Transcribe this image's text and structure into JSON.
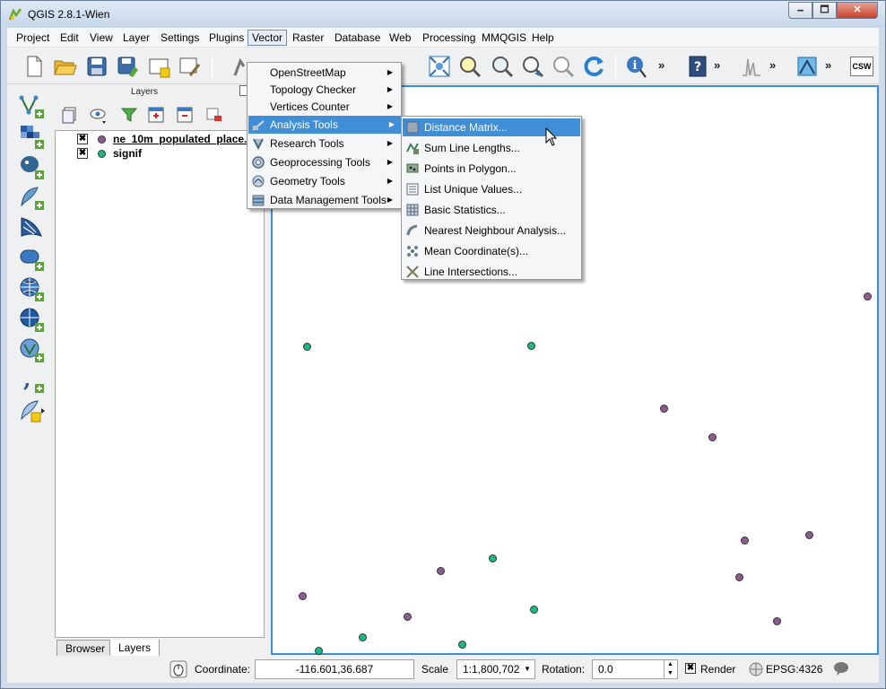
{
  "window": {
    "title": "QGIS 2.8.1-Wien",
    "min_glyph": "🗕",
    "max_glyph": "🗖",
    "close_glyph": "✕"
  },
  "menubar": {
    "items": [
      "Project",
      "Edit",
      "View",
      "Layer",
      "Settings",
      "Plugins",
      "Vector",
      "Raster",
      "Database",
      "Web",
      "Processing",
      "MMQGIS",
      "Help"
    ],
    "active": "Vector"
  },
  "vector_menu": {
    "items": [
      {
        "label": "OpenStreetMap",
        "submenu": true,
        "icon": "none"
      },
      {
        "label": "Topology Checker",
        "submenu": true,
        "icon": "none"
      },
      {
        "label": "Vertices Counter",
        "submenu": true,
        "icon": "none"
      },
      {
        "label": "Analysis Tools",
        "submenu": true,
        "icon": "analysis-icon",
        "highlighted": true
      },
      {
        "label": "Research Tools",
        "submenu": true,
        "icon": "research-icon"
      },
      {
        "label": "Geoprocessing Tools",
        "submenu": true,
        "icon": "geoprocessing-icon"
      },
      {
        "label": "Geometry Tools",
        "submenu": true,
        "icon": "geometry-icon"
      },
      {
        "label": "Data Management Tools",
        "submenu": true,
        "icon": "data-management-icon"
      }
    ]
  },
  "analysis_submenu": {
    "items": [
      {
        "label": "Distance Matrix...",
        "icon": "distance-matrix-icon",
        "highlighted": true
      },
      {
        "label": "Sum Line Lengths...",
        "icon": "sum-line-lengths-icon"
      },
      {
        "label": "Points in Polygon...",
        "icon": "points-in-polygon-icon"
      },
      {
        "label": "List Unique Values...",
        "icon": "list-unique-values-icon"
      },
      {
        "label": "Basic Statistics...",
        "icon": "basic-statistics-icon"
      },
      {
        "label": "Nearest Neighbour Analysis...",
        "icon": "nearest-neighbour-icon"
      },
      {
        "label": "Mean Coordinate(s)...",
        "icon": "mean-coordinate-icon"
      },
      {
        "label": "Line Intersections...",
        "icon": "line-intersections-icon"
      }
    ]
  },
  "layers_panel": {
    "title": "Layers",
    "layers": [
      {
        "name": "ne_10m_populated_place...",
        "visible": true,
        "color": "#8e5b94",
        "check_glyph": "✖"
      },
      {
        "name": "signif",
        "visible": true,
        "color": "#1fb884",
        "check_glyph": "✖"
      }
    ],
    "tabs": [
      "Browser",
      "Layers"
    ],
    "active_tab": "Layers"
  },
  "map_points": {
    "purple": "#8e5b94",
    "green": "#1fb884"
  },
  "statusbar": {
    "coordinate_label": "Coordinate:",
    "coordinate_value": "-116.601,36.687",
    "scale_label": "Scale",
    "scale_value": "1:1,800,702",
    "rotation_label": "Rotation:",
    "rotation_value": "0.0",
    "render_label": "Render",
    "render_check_glyph": "✖",
    "crs": "EPSG:4326"
  },
  "toolbar": {
    "more_glyph": "»",
    "csw_label": "CSW"
  }
}
